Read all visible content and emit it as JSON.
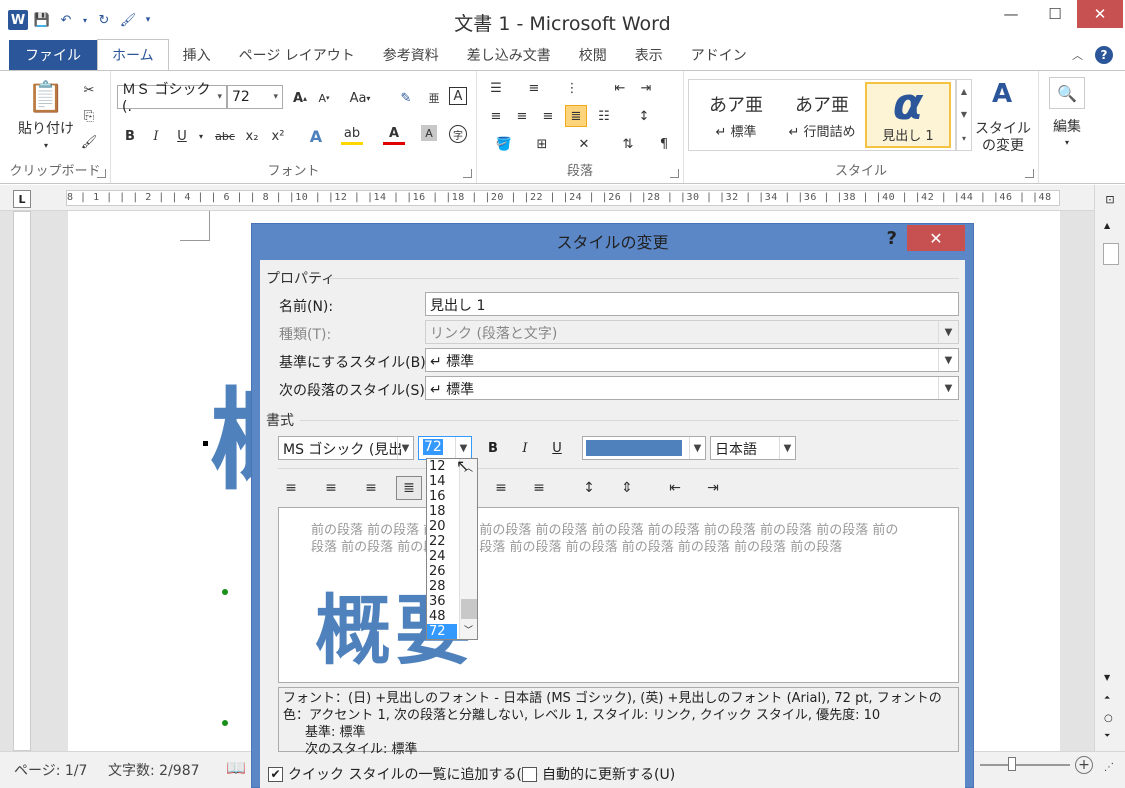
{
  "app": {
    "title": "文書 1 - Microsoft Word",
    "qat_icons": [
      "word-logo",
      "save-icon",
      "undo-icon",
      "redo-icon",
      "format-painter-icon",
      "customize-qat-icon"
    ]
  },
  "tabs": {
    "file": "ファイル",
    "items": [
      "ホーム",
      "挿入",
      "ページ レイアウト",
      "参考資料",
      "差し込み文書",
      "校閲",
      "表示",
      "アドイン"
    ],
    "active": "ホーム"
  },
  "ribbon": {
    "clipboard": {
      "label": "クリップボード",
      "paste": "貼り付け"
    },
    "font": {
      "label": "フォント",
      "font_name": "ＭＳ ゴシック (.",
      "font_size": "72",
      "change_case": "Aa",
      "bold": "B",
      "italic": "I",
      "underline": "U",
      "strike": "abc",
      "sub": "x₂",
      "sup": "x²"
    },
    "paragraph": {
      "label": "段落"
    },
    "styles": {
      "label": "スタイル",
      "items": [
        {
          "preview": "あア亜",
          "name": "↵ 標準"
        },
        {
          "preview": "あア亜",
          "name": "↵ 行間詰め"
        },
        {
          "preview": "α",
          "name": "見出し 1"
        }
      ],
      "change_styles": "スタイルの変更"
    },
    "editing": {
      "label": "編集"
    }
  },
  "ruler": {
    "text": "8 | 1 | | | 2 | | 4 | | 6 | | 8 | |10 | |12 | |14 | |16 | |18 | |20 | |22 | |24 | |26 | |28 | |30 | |32 | |34 | |36 | |38 | |40 | |42 | |44 | |46 | |48 |",
    "corner": "L"
  },
  "statusbar": {
    "page": "ページ: 1/7",
    "words": "文字数: 2/987"
  },
  "dialog": {
    "title": "スタイルの変更",
    "help": "?",
    "properties_label": "プロパティ",
    "name_label": "名前(N):",
    "name_value": "見出し 1",
    "type_label": "種類(T):",
    "type_value": "リンク (段落と文字)",
    "base_label": "基準にするスタイル(B):",
    "base_value": "↵ 標準",
    "next_label": "次の段落のスタイル(S):",
    "next_value": "↵ 標準",
    "format_label": "書式",
    "font_value": "MS ゴシック (見出",
    "size_value": "72",
    "bold": "B",
    "italic": "I",
    "underline": "U",
    "color_hex": "#4f81bd",
    "language_value": "日本語",
    "size_options": [
      "12",
      "14",
      "16",
      "18",
      "20",
      "22",
      "24",
      "26",
      "28",
      "36",
      "48",
      "72"
    ],
    "preview_prev_para": "前の段落 前の段落 前の段落 前の段落 前の段落 前の段落 前の段落 前の段落 前の段落 前の段落 前の段落 前の段落 前の段落 前の段落 前の段落 前の段落 前の段落 前の段落 前の段落 前の段落",
    "preview_heading": "概要",
    "description_line1": "フォント：(日) +見出しのフォント - 日本語 (MS ゴシック), (英) +見出しのフォント (Arial), 72 pt, フォントの色：アクセント 1, 次の段落と分離しない, レベル 1, スタイル: リンク, クイック スタイル, 優先度: 10",
    "description_base": "基準: 標準",
    "description_next": "次のスタイル: 標準",
    "chk_quickstyle": "クイック スタイルの一覧に追加する(Q)",
    "chk_autoupdate": "自動的に更新する(U)"
  },
  "document": {
    "heading_glyph": "概"
  }
}
